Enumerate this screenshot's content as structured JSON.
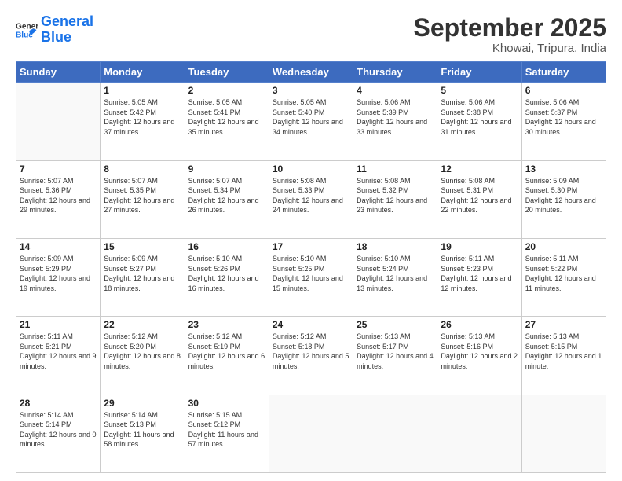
{
  "header": {
    "logo_general": "General",
    "logo_blue": "Blue",
    "title": "September 2025",
    "location": "Khowai, Tripura, India"
  },
  "weekdays": [
    "Sunday",
    "Monday",
    "Tuesday",
    "Wednesday",
    "Thursday",
    "Friday",
    "Saturday"
  ],
  "weeks": [
    [
      {
        "day": "",
        "empty": true
      },
      {
        "day": "1",
        "rise": "5:05 AM",
        "set": "5:42 PM",
        "daylight": "12 hours and 37 minutes."
      },
      {
        "day": "2",
        "rise": "5:05 AM",
        "set": "5:41 PM",
        "daylight": "12 hours and 35 minutes."
      },
      {
        "day": "3",
        "rise": "5:05 AM",
        "set": "5:40 PM",
        "daylight": "12 hours and 34 minutes."
      },
      {
        "day": "4",
        "rise": "5:06 AM",
        "set": "5:39 PM",
        "daylight": "12 hours and 33 minutes."
      },
      {
        "day": "5",
        "rise": "5:06 AM",
        "set": "5:38 PM",
        "daylight": "12 hours and 31 minutes."
      },
      {
        "day": "6",
        "rise": "5:06 AM",
        "set": "5:37 PM",
        "daylight": "12 hours and 30 minutes."
      }
    ],
    [
      {
        "day": "7",
        "rise": "5:07 AM",
        "set": "5:36 PM",
        "daylight": "12 hours and 29 minutes."
      },
      {
        "day": "8",
        "rise": "5:07 AM",
        "set": "5:35 PM",
        "daylight": "12 hours and 27 minutes."
      },
      {
        "day": "9",
        "rise": "5:07 AM",
        "set": "5:34 PM",
        "daylight": "12 hours and 26 minutes."
      },
      {
        "day": "10",
        "rise": "5:08 AM",
        "set": "5:33 PM",
        "daylight": "12 hours and 24 minutes."
      },
      {
        "day": "11",
        "rise": "5:08 AM",
        "set": "5:32 PM",
        "daylight": "12 hours and 23 minutes."
      },
      {
        "day": "12",
        "rise": "5:08 AM",
        "set": "5:31 PM",
        "daylight": "12 hours and 22 minutes."
      },
      {
        "day": "13",
        "rise": "5:09 AM",
        "set": "5:30 PM",
        "daylight": "12 hours and 20 minutes."
      }
    ],
    [
      {
        "day": "14",
        "rise": "5:09 AM",
        "set": "5:29 PM",
        "daylight": "12 hours and 19 minutes."
      },
      {
        "day": "15",
        "rise": "5:09 AM",
        "set": "5:27 PM",
        "daylight": "12 hours and 18 minutes."
      },
      {
        "day": "16",
        "rise": "5:10 AM",
        "set": "5:26 PM",
        "daylight": "12 hours and 16 minutes."
      },
      {
        "day": "17",
        "rise": "5:10 AM",
        "set": "5:25 PM",
        "daylight": "12 hours and 15 minutes."
      },
      {
        "day": "18",
        "rise": "5:10 AM",
        "set": "5:24 PM",
        "daylight": "12 hours and 13 minutes."
      },
      {
        "day": "19",
        "rise": "5:11 AM",
        "set": "5:23 PM",
        "daylight": "12 hours and 12 minutes."
      },
      {
        "day": "20",
        "rise": "5:11 AM",
        "set": "5:22 PM",
        "daylight": "12 hours and 11 minutes."
      }
    ],
    [
      {
        "day": "21",
        "rise": "5:11 AM",
        "set": "5:21 PM",
        "daylight": "12 hours and 9 minutes."
      },
      {
        "day": "22",
        "rise": "5:12 AM",
        "set": "5:20 PM",
        "daylight": "12 hours and 8 minutes."
      },
      {
        "day": "23",
        "rise": "5:12 AM",
        "set": "5:19 PM",
        "daylight": "12 hours and 6 minutes."
      },
      {
        "day": "24",
        "rise": "5:12 AM",
        "set": "5:18 PM",
        "daylight": "12 hours and 5 minutes."
      },
      {
        "day": "25",
        "rise": "5:13 AM",
        "set": "5:17 PM",
        "daylight": "12 hours and 4 minutes."
      },
      {
        "day": "26",
        "rise": "5:13 AM",
        "set": "5:16 PM",
        "daylight": "12 hours and 2 minutes."
      },
      {
        "day": "27",
        "rise": "5:13 AM",
        "set": "5:15 PM",
        "daylight": "12 hours and 1 minute."
      }
    ],
    [
      {
        "day": "28",
        "rise": "5:14 AM",
        "set": "5:14 PM",
        "daylight": "12 hours and 0 minutes."
      },
      {
        "day": "29",
        "rise": "5:14 AM",
        "set": "5:13 PM",
        "daylight": "11 hours and 58 minutes."
      },
      {
        "day": "30",
        "rise": "5:15 AM",
        "set": "5:12 PM",
        "daylight": "11 hours and 57 minutes."
      },
      {
        "day": "",
        "empty": true
      },
      {
        "day": "",
        "empty": true
      },
      {
        "day": "",
        "empty": true
      },
      {
        "day": "",
        "empty": true
      }
    ]
  ],
  "labels": {
    "sunrise": "Sunrise:",
    "sunset": "Sunset:",
    "daylight": "Daylight:"
  }
}
